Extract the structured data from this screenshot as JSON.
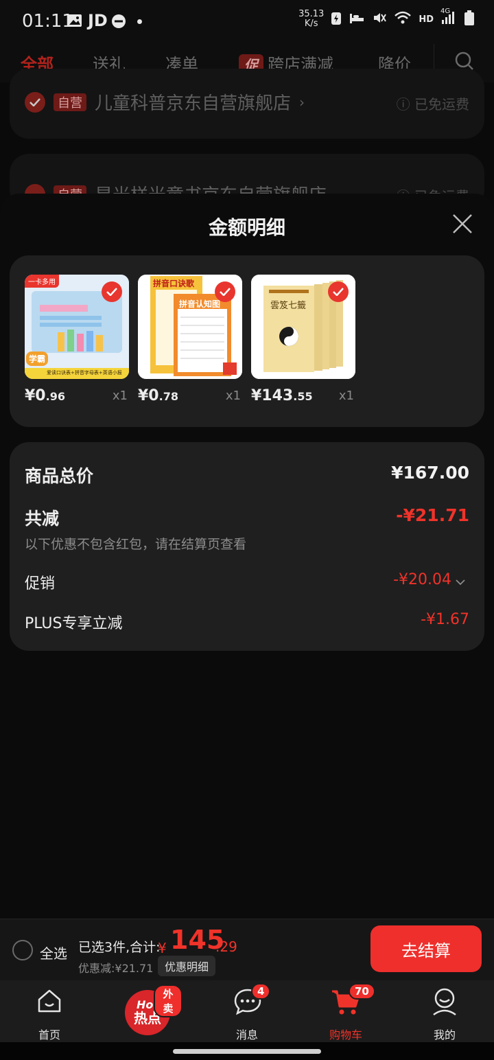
{
  "status_bar": {
    "time": "01:11",
    "app": "JD",
    "speed_value": "35.13",
    "speed_unit": "K/s",
    "network": "HD",
    "signal": "4G"
  },
  "tabs": [
    {
      "label": "全部"
    },
    {
      "label": "送礼"
    },
    {
      "label": "凑单"
    },
    {
      "tag": "促",
      "label": "跨店满减"
    },
    {
      "label": "降价"
    }
  ],
  "bg_stores": [
    {
      "tag": "自营",
      "name": "儿童科普京东自营旗舰店",
      "shipping": "已免运费"
    },
    {
      "tag": "自营",
      "name": "星光样光童书京东自营旗舰店",
      "shipping": "已免运费"
    }
  ],
  "sheet": {
    "title": "金额明细",
    "items": [
      {
        "price_int": "¥0",
        "price_dec": ".96",
        "qty": "x1",
        "thumb_tag": "一卡多用",
        "thumb_badge": "学霸",
        "thumb_caption": "爱读口诀表+拼音字母表+英语小报"
      },
      {
        "price_int": "¥0",
        "price_dec": ".78",
        "qty": "x1",
        "thumb_title_a": "拼音口诀歌",
        "thumb_title_b": "拼音认知图"
      },
      {
        "price_int": "¥143",
        "price_dec": ".55",
        "qty": "x1",
        "thumb_title": "雲笈七籤"
      }
    ],
    "summary": {
      "total_label": "商品总价",
      "total_value": "¥167.00",
      "reduce_label": "共减",
      "reduce_value": "-¥21.71",
      "reduce_note": "以下优惠不包含红包，请在结算页查看",
      "promo_label": "促销",
      "promo_value": "-¥20.04",
      "plus_label": "PLUS专享立减",
      "plus_value": "-¥1.67"
    }
  },
  "checkout": {
    "select_all": "全选",
    "selected_text": "已选3件,合计:",
    "total_yen": "¥",
    "total_int": "145",
    "total_dec": ".29",
    "discount_text": "优惠减:¥21.71",
    "detail_chip": "优惠明细",
    "button": "去结算"
  },
  "bottom_nav": [
    {
      "label": "首页",
      "icon": "home-icon"
    },
    {
      "label": "",
      "icon": "hot-icon",
      "badge": "外卖",
      "hot_top": "Hot",
      "hot_bottom": "热点"
    },
    {
      "label": "消息",
      "icon": "message-icon",
      "badge": "4"
    },
    {
      "label": "购物车",
      "icon": "cart-icon",
      "badge": "70",
      "active": true
    },
    {
      "label": "我的",
      "icon": "profile-icon"
    }
  ],
  "colors": {
    "accent": "#f0332a",
    "card": "#1f1f1f",
    "background": "#0a0a0a"
  }
}
